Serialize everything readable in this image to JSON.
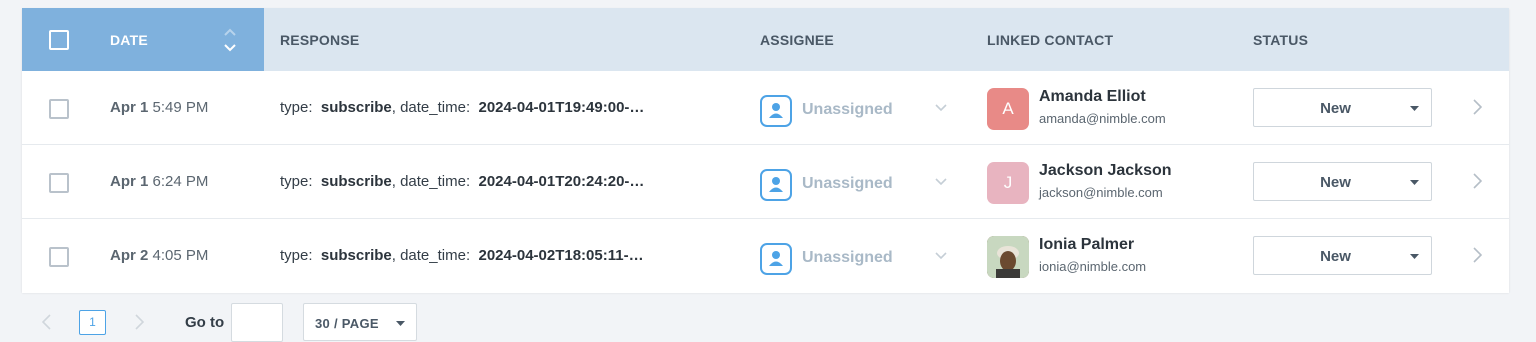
{
  "table": {
    "columns": {
      "date": "DATE",
      "response": "RESPONSE",
      "assignee": "ASSIGNEE",
      "linked_contact": "LINKED CONTACT",
      "status": "STATUS"
    },
    "rows": [
      {
        "date_bold": "Apr 1",
        "time": "5:49 PM",
        "resp_type_key": "type:",
        "resp_type_val": "subscribe",
        "resp_dt_key": ", date_time:",
        "resp_dt_val": "2024-04-01T19:49:00-…",
        "assignee": "Unassigned",
        "contact_initial": "A",
        "contact_name": "Amanda Elliot",
        "contact_email": "amanda@nimble.com",
        "avatar_color": "#e88a87",
        "status": "New"
      },
      {
        "date_bold": "Apr 1",
        "time": "6:24 PM",
        "resp_type_key": "type:",
        "resp_type_val": "subscribe",
        "resp_dt_key": ", date_time:",
        "resp_dt_val": "2024-04-01T20:24:20-…",
        "assignee": "Unassigned",
        "contact_initial": "J",
        "contact_name": "Jackson Jackson",
        "contact_email": "jackson@nimble.com",
        "avatar_color": "#e8b4c0",
        "status": "New"
      },
      {
        "date_bold": "Apr 2",
        "time": "4:05 PM",
        "resp_type_key": "type:",
        "resp_type_val": "subscribe",
        "resp_dt_key": ", date_time:",
        "resp_dt_val": "2024-04-02T18:05:11-…",
        "assignee": "Unassigned",
        "contact_initial": "",
        "contact_name": "Ionia Palmer",
        "contact_email": "ionia@nimble.com",
        "avatar_color": "#7a5a3e",
        "status": "New"
      }
    ]
  },
  "pagination": {
    "current_page": "1",
    "goto_label": "Go to",
    "goto_value": "",
    "per_page": "30 / PAGE"
  },
  "colors": {
    "header_bg": "#dbe6f0",
    "date_header_bg": "#7fb1dd",
    "accent": "#4da3e6"
  }
}
